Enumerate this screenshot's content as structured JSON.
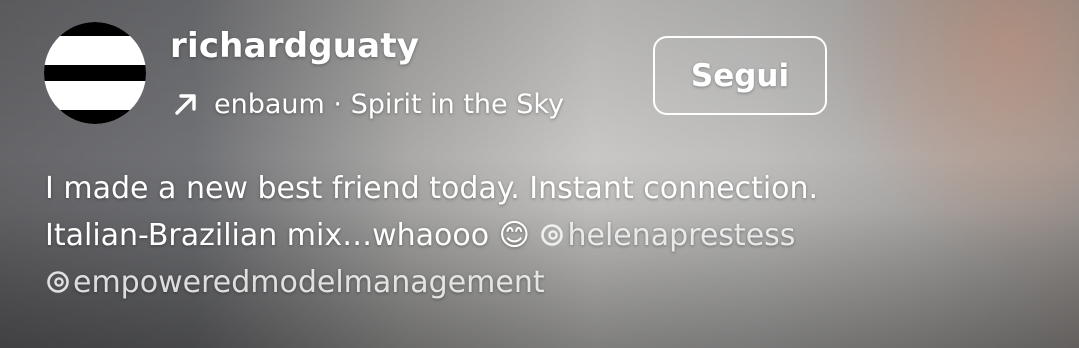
{
  "post": {
    "username": "richardguaty",
    "audio": {
      "icon": "arrow-up-right-icon",
      "text": "enbaum · Spirit in the Sky"
    },
    "follow_label": "Segui",
    "caption": {
      "line1": "I made a new best friend today. Instant connection.",
      "line2_text": "Italian-Brazilian mix…whaooo 😊",
      "mention1": "helenaprestess",
      "mention2": "empoweredmodelmanagement"
    }
  },
  "colors": {
    "text": "#ffffff",
    "avatar_stripe": "#000000",
    "avatar_bg": "#ffffff"
  }
}
